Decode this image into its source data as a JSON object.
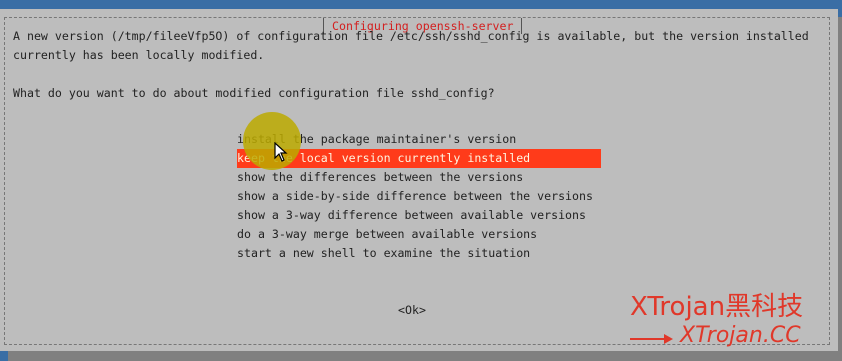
{
  "dialog": {
    "title": "Configuring openssh-server",
    "line1": "A new version (/tmp/fileeVfp5O) of configuration file /etc/ssh/sshd_config is available, but the version installed",
    "line2": "currently has been locally modified.",
    "question": "What do you want to do about modified configuration file sshd_config?",
    "options": [
      "install the package maintainer's version",
      "keep the local version currently installed",
      "show the differences between the versions",
      "show a side-by-side difference between the versions",
      "show a 3-way difference between available versions",
      "do a 3-way merge between available versions",
      "start a new shell to examine the situation"
    ],
    "selected_index": 1,
    "ok_label": "<Ok>"
  },
  "watermark": {
    "line1": "XTrojan黑科技",
    "line2": "XTrojan.CC",
    "color": "#e0382a"
  },
  "icons": {
    "pointer": "mouse-pointer-icon",
    "arrow": "right-arrow-icon"
  },
  "colors": {
    "background": "#3a6ea5",
    "dialog": "#bdbdbd",
    "selection": "#ff3b1a",
    "title": "#d32020"
  }
}
